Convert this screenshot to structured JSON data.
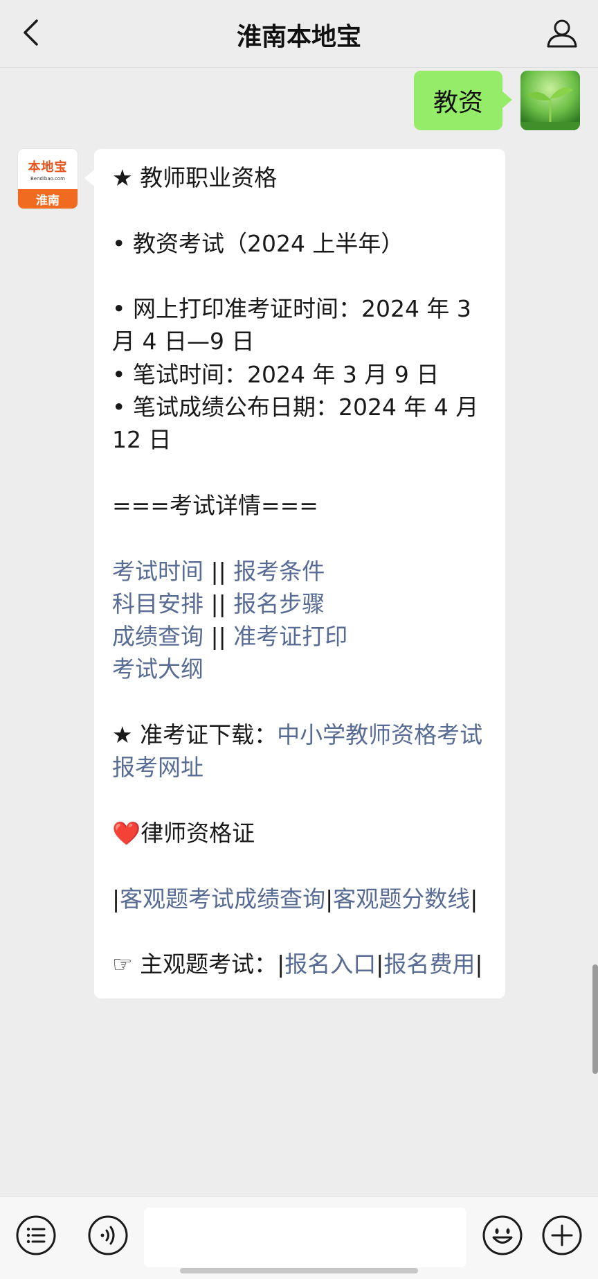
{
  "header": {
    "title": "淮南本地宝"
  },
  "user_message": {
    "text": "教资"
  },
  "bot_avatar": {
    "logo_text": "本地宝",
    "logo_sub": "Bendibao.com",
    "city": "淮南"
  },
  "bot_message": {
    "section1_title": "★ 教师职业资格",
    "exam_name": "• 教资考试（2024 上半年）",
    "print_time": "• 网上打印准考证时间：2024 年 3 月 4 日—9 日",
    "written_time": "• 笔试时间：2024 年 3 月 9 日",
    "score_date": "• 笔试成绩公布日期：2024 年 4 月 12 日",
    "details_heading": "===考试详情===",
    "links_row1": {
      "a": "考试时间",
      "sep": " || ",
      "b": "报考条件"
    },
    "links_row2": {
      "a": "科目安排",
      "sep": " || ",
      "b": "报名步骤"
    },
    "links_row3": {
      "a": "成绩查询",
      "sep": " || ",
      "b": "准考证打印"
    },
    "links_row4": {
      "a": "考试大纲"
    },
    "download_label": "★ 准考证下载：",
    "download_link": "中小学教师资格考试报考网址",
    "section2_heart": "❤️",
    "section2_title": "律师资格证",
    "lawyer_pipe_start": "|",
    "lawyer_link1": "客观题考试成绩查询",
    "lawyer_pipe_mid": "|",
    "lawyer_link2": "客观题分数线",
    "lawyer_pipe_end": "|",
    "subjective_label": "☞ 主观题考试：|",
    "subjective_link1": "报名入口",
    "subjective_pipe": "|",
    "subjective_link2": "报名费用",
    "subjective_pipe_end": "|"
  },
  "icons": {
    "back": "chevron-left-icon",
    "profile": "person-icon",
    "menu": "list-menu-icon",
    "voice": "voice-icon",
    "emoji": "smiley-icon",
    "plus": "plus-icon"
  },
  "colors": {
    "background": "#ededed",
    "user_bubble": "#95ec69",
    "link": "#576b95",
    "brand_orange": "#f06a20"
  }
}
